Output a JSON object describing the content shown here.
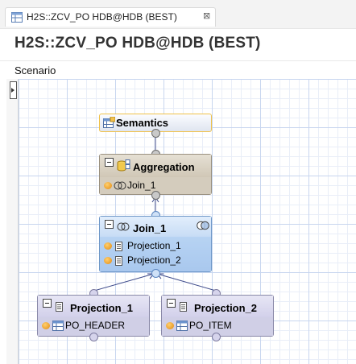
{
  "tab": {
    "label": "H2S::ZCV_PO HDB@HDB (BEST)",
    "close_glyph": "⊠",
    "icon": "calculation-view-icon"
  },
  "editor": {
    "title": "H2S::ZCV_PO HDB@HDB (BEST)",
    "section": "Scenario"
  },
  "palette": {
    "toggle_icon": "expand-palette-icon"
  },
  "nodes": {
    "semantics": {
      "title": "Semantics",
      "icon": "semantics-table-icon"
    },
    "aggregation": {
      "title": "Aggregation",
      "icon": "aggregation-icon",
      "inputs": [
        {
          "label": "Join_1",
          "icon": "join-icon"
        }
      ]
    },
    "join_1": {
      "title": "Join_1",
      "icon": "join-icon",
      "badge_icon": "join-type-icon",
      "inputs": [
        {
          "label": "Projection_1",
          "icon": "projection-icon"
        },
        {
          "label": "Projection_2",
          "icon": "projection-icon"
        }
      ]
    },
    "projection_1": {
      "title": "Projection_1",
      "icon": "projection-icon",
      "inputs": [
        {
          "label": "PO_HEADER",
          "icon": "table-icon"
        }
      ]
    },
    "projection_2": {
      "title": "Projection_2",
      "icon": "projection-icon",
      "inputs": [
        {
          "label": "PO_ITEM",
          "icon": "table-icon"
        }
      ]
    }
  },
  "colors": {
    "semantics_border": "#f0c24a",
    "aggregation_fill": "#d9d1c2",
    "join_fill": "#bcd7f4",
    "projection_fill": "#d8d7ec",
    "edge_color": "#3d4a8a",
    "grid_major": "#c8d6ef",
    "grid_minor": "#e9eef8"
  }
}
